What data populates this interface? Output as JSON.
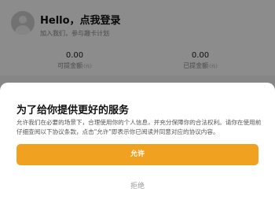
{
  "profile": {
    "title": "Hello，点我登录",
    "subtitle": "加入我们，参与趣卡计划"
  },
  "stats": [
    {
      "value": "0.00",
      "label": "可提金额",
      "unit": "(元)"
    },
    {
      "value": "0.00",
      "label": "已提金额",
      "unit": "(元)"
    }
  ],
  "dialog": {
    "title": "为了给你提供更好的服务",
    "description": "允许我们在必要的场景下，合理使用你的个人信息，并充分保障你的合法权利。请你在使用前仔细查阅以下协议条款，点击\"允许\"即表示你已阅读并同意对应的协议内容。",
    "allow_label": "允许",
    "reject_label": "拒绝"
  },
  "colors": {
    "accent": "#f0a11f",
    "overlay": "rgba(0,0,0,0.45)"
  }
}
